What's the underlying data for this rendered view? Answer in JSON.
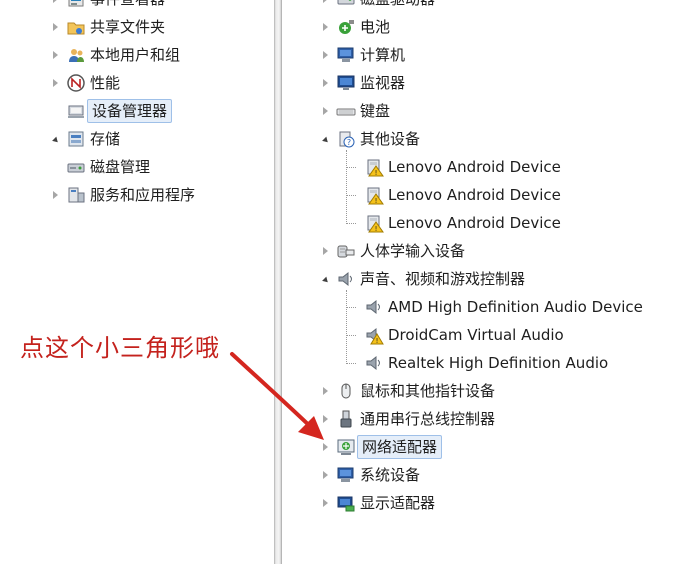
{
  "left_tree": {
    "items": [
      {
        "label": "事件查看器",
        "icon": "event-viewer-icon",
        "expander": "collapsed"
      },
      {
        "label": "共享文件夹",
        "icon": "shared-folder-icon",
        "expander": "collapsed"
      },
      {
        "label": "本地用户和组",
        "icon": "local-users-icon",
        "expander": "collapsed"
      },
      {
        "label": "性能",
        "icon": "performance-icon",
        "expander": "collapsed"
      },
      {
        "label": "设备管理器",
        "icon": "device-manager-icon",
        "expander": "none",
        "selected": true
      },
      {
        "label": "存储",
        "icon": "storage-icon",
        "expander": "expanded"
      },
      {
        "label": "磁盘管理",
        "icon": "disk-management-icon",
        "expander": "none"
      },
      {
        "label": "服务和应用程序",
        "icon": "services-icon",
        "expander": "collapsed"
      }
    ]
  },
  "device_tree": {
    "items": [
      {
        "label": "磁盘驱动器",
        "icon": "disk-drive-icon",
        "expander": "collapsed"
      },
      {
        "label": "电池",
        "icon": "battery-icon",
        "expander": "collapsed"
      },
      {
        "label": "计算机",
        "icon": "computer-icon",
        "expander": "collapsed"
      },
      {
        "label": "监视器",
        "icon": "monitor-icon",
        "expander": "collapsed"
      },
      {
        "label": "键盘",
        "icon": "keyboard-icon",
        "expander": "collapsed"
      },
      {
        "label": "其他设备",
        "icon": "unknown-device-icon",
        "expander": "expanded"
      },
      {
        "label": "Lenovo Android Device",
        "icon": "warning-device-icon",
        "child": true
      },
      {
        "label": "Lenovo Android Device",
        "icon": "warning-device-icon",
        "child": true
      },
      {
        "label": "Lenovo Android Device",
        "icon": "warning-device-icon",
        "child": true
      },
      {
        "label": "人体学输入设备",
        "icon": "hid-icon",
        "expander": "collapsed"
      },
      {
        "label": "声音、视频和游戏控制器",
        "icon": "speaker-icon",
        "expander": "expanded"
      },
      {
        "label": "AMD High Definition Audio Device",
        "icon": "speaker-icon",
        "child": true
      },
      {
        "label": "DroidCam Virtual Audio",
        "icon": "warning-speaker-icon",
        "child": true
      },
      {
        "label": "Realtek High Definition Audio",
        "icon": "speaker-icon",
        "child": true
      },
      {
        "label": "鼠标和其他指针设备",
        "icon": "mouse-icon",
        "expander": "collapsed"
      },
      {
        "label": "通用串行总线控制器",
        "icon": "usb-icon",
        "expander": "collapsed"
      },
      {
        "label": "网络适配器",
        "icon": "network-adapter-icon",
        "expander": "collapsed",
        "highlighted": true
      },
      {
        "label": "系统设备",
        "icon": "system-device-icon",
        "expander": "collapsed"
      },
      {
        "label": "显示适配器",
        "icon": "display-adapter-icon",
        "expander": "collapsed"
      }
    ]
  },
  "annotation": {
    "text": "点这个小三角形哦",
    "color": "#c4221d"
  },
  "colors": {
    "selection_bg": "#e5eef9",
    "selection_border": "#9fc0e8",
    "expander_collapsed": "#a6a6a6",
    "expander_expanded": "#404040"
  }
}
